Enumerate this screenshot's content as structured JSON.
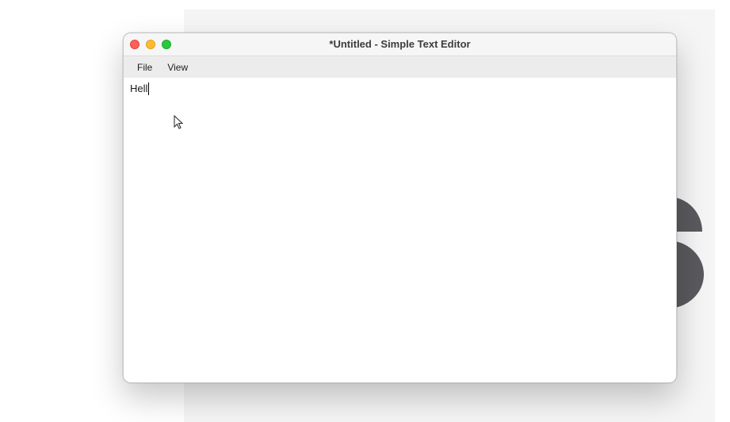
{
  "window": {
    "title": "*Untitled - Simple Text Editor"
  },
  "menubar": {
    "items": [
      {
        "label": "File"
      },
      {
        "label": "View"
      }
    ]
  },
  "editor": {
    "content": "Hell"
  },
  "icons": {
    "close": "close-traffic-light",
    "minimize": "minimize-traffic-light",
    "zoom": "zoom-traffic-light",
    "pointer": "mouse-pointer-icon"
  },
  "colors": {
    "close": "#fe5f57",
    "minimize": "#febc2e",
    "zoom": "#28c840",
    "menubar": "#ececec",
    "titlebar": "#f6f6f6"
  }
}
